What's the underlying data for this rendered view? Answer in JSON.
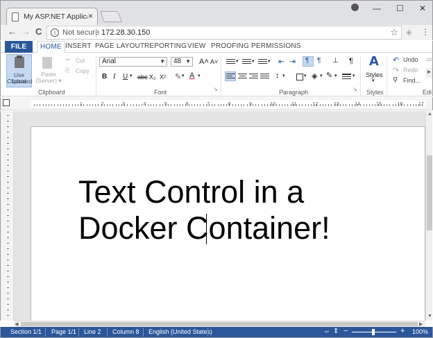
{
  "browser": {
    "tab_title": "My ASP.NET Application",
    "tab_close": "×",
    "address": {
      "security_text": "Not secure",
      "url": "172.28.30.150"
    },
    "nav": {
      "back": "←",
      "forward": "→",
      "reload": "C"
    },
    "window": {
      "minimize": "—",
      "maximize": "☐",
      "close": "✕"
    }
  },
  "ribbon": {
    "tabs": [
      "FILE",
      "HOME",
      "INSERT",
      "PAGE LAYOUT",
      "REPORTING",
      "VIEW",
      "PROOFING",
      "PERMISSIONS"
    ],
    "active_tab": "HOME",
    "clipboard": {
      "use_local_label_1": "Use Local",
      "use_local_label_2": "Clipboard",
      "paste_label_1": "Paste",
      "paste_label_2": "(Server) ▾",
      "cut": "Cut",
      "copy": "Copy",
      "group_label": "Clipboard"
    },
    "font": {
      "family": "Arial",
      "size": "48",
      "bold": "B",
      "italic": "I",
      "underline": "U",
      "strike": "abc",
      "subscript": "X₂",
      "superscript": "X²",
      "grow": "A˄",
      "shrink": "A˅",
      "group_label": "Font"
    },
    "paragraph": {
      "pilcrow": "¶",
      "group_label": "Paragraph"
    },
    "styles": {
      "label": "Styles",
      "group_label": "Styles"
    },
    "editing": {
      "undo": "Undo",
      "redo": "Redo",
      "find": "Find...",
      "group_label": "Edi"
    }
  },
  "ruler": {
    "numbers": [
      "1",
      "2",
      "3",
      "4",
      "5",
      "6",
      "7",
      "8",
      "9",
      "10",
      "11",
      "12",
      "13",
      "14",
      "15",
      "16",
      "17"
    ]
  },
  "document": {
    "line1": "Text Control in a",
    "line2": "Docker Container!"
  },
  "status": {
    "section": "Section 1/1",
    "page": "Page 1/1",
    "line": "Line 2",
    "column": "Column 8",
    "language": "English (United States)",
    "zoom": "100%",
    "zoom_minus": "−",
    "zoom_plus": "+"
  },
  "colors": {
    "accent": "#2b579a",
    "active_highlight": "#c5d9f1"
  }
}
